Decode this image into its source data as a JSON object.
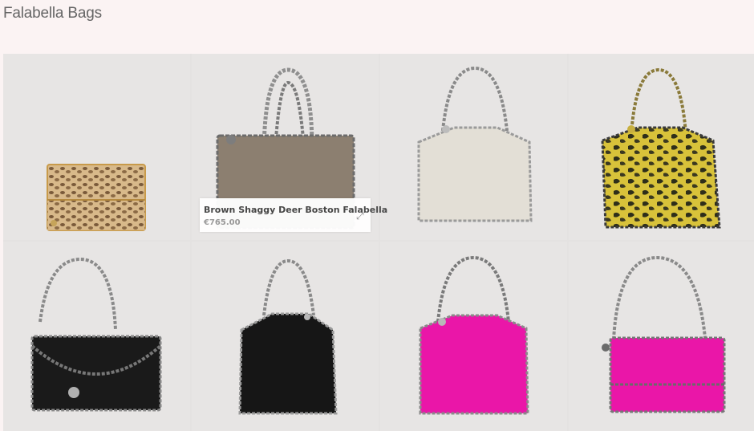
{
  "page": {
    "title": "Falabella Bags"
  },
  "products": [
    {
      "id": "python-clutch",
      "name": ""
    },
    {
      "id": "brown-shaggy-deer",
      "name": "Brown Shaggy Deer Boston Falabella",
      "price": "€765.00"
    },
    {
      "id": "cream-tote",
      "name": ""
    },
    {
      "id": "yellow-python-tote",
      "name": ""
    },
    {
      "id": "black-foldover",
      "name": ""
    },
    {
      "id": "black-tote",
      "name": ""
    },
    {
      "id": "pink-tote",
      "name": ""
    },
    {
      "id": "pink-clutch",
      "name": ""
    }
  ],
  "tooltip": {
    "name": "Brown Shaggy Deer Boston Falabella",
    "price": "€765.00",
    "expand_icon": "expand-icon"
  },
  "colors": {
    "background": "#fbf3f3",
    "tile": "#e7e5e4",
    "hot_pink": "#ea16a8",
    "python_yellow": "#d8c23a",
    "chain": "#8a8a8a"
  }
}
